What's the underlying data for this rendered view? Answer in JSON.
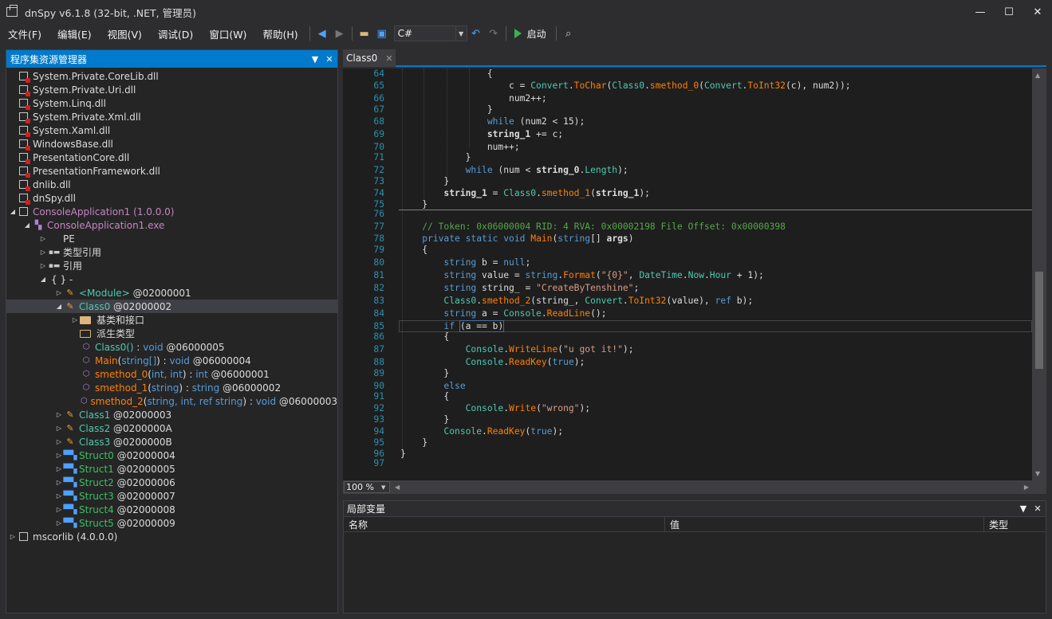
{
  "window": {
    "title": "dnSpy v6.1.8 (32-bit, .NET, 管理员)",
    "minimize": "—",
    "maximize": "☐",
    "close": "✕"
  },
  "menu": {
    "items": [
      "文件(F)",
      "编辑(E)",
      "视图(V)",
      "调试(D)",
      "窗口(W)",
      "帮助(H)"
    ]
  },
  "toolbar": {
    "language": "C#",
    "start_label": "启动"
  },
  "explorer": {
    "title": "程序集资源管理器",
    "dlls": [
      "System.Private.CoreLib.dll",
      "System.Private.Uri.dll",
      "System.Linq.dll",
      "System.Private.Xml.dll",
      "System.Xaml.dll",
      "WindowsBase.dll",
      "PresentationCore.dll",
      "PresentationFramework.dll",
      "dnlib.dll",
      "dnSpy.dll"
    ],
    "assembly": "ConsoleApplication1 (1.0.0.0)",
    "module": "ConsoleApplication1.exe",
    "pe": "PE",
    "typerefs": "类型引用",
    "refs": "引用",
    "ns": "{ } -",
    "module_type": {
      "name": "<Module>",
      "token": "@02000001"
    },
    "class0": {
      "name": "Class0",
      "token": "@02000002"
    },
    "base_types": "基类和接口",
    "derived_types": "派生类型",
    "members": [
      {
        "name": "Class0()",
        "sig": " : ",
        "ret": "void",
        "token": " @06000005"
      },
      {
        "name": "Main",
        "sig": "(",
        "params": "string[]",
        "close": ") : ",
        "ret": "void",
        "token": " @06000004"
      },
      {
        "name": "smethod_0",
        "sig": "(",
        "params": "int, int",
        "close": ") : ",
        "ret": "int",
        "token": " @06000001"
      },
      {
        "name": "smethod_1",
        "sig": "(",
        "params": "string",
        "close": ") : ",
        "ret": "string",
        "token": " @06000002"
      },
      {
        "name": "smethod_2",
        "sig": "(",
        "params": "string, int, ref string",
        "close": ") : ",
        "ret": "void",
        "token": " @06000003"
      }
    ],
    "classes": [
      {
        "name": "Class1",
        "token": "@02000003"
      },
      {
        "name": "Class2",
        "token": "@0200000A"
      },
      {
        "name": "Class3",
        "token": "@0200000B"
      }
    ],
    "structs": [
      {
        "name": "Struct0",
        "token": "@02000004"
      },
      {
        "name": "Struct1",
        "token": "@02000005"
      },
      {
        "name": "Struct2",
        "token": "@02000006"
      },
      {
        "name": "Struct3",
        "token": "@02000007"
      },
      {
        "name": "Struct4",
        "token": "@02000008"
      },
      {
        "name": "Struct5",
        "token": "@02000009"
      }
    ],
    "mscorlib": "mscorlib (4.0.0.0)"
  },
  "editor": {
    "tab": "Class0",
    "zoom": "100 %",
    "line_numbers": [
      "64",
      "65",
      "66",
      "67",
      "68",
      "69",
      "70",
      "71",
      "72",
      "73",
      "74",
      "75",
      "76",
      "77",
      "78",
      "79",
      "80",
      "81",
      "82",
      "83",
      "84",
      "85",
      "86",
      "87",
      "88",
      "89",
      "90",
      "91",
      "92",
      "93",
      "94",
      "95",
      "96",
      "97"
    ]
  },
  "locals": {
    "title": "局部变量",
    "columns": [
      "名称",
      "值",
      "类型"
    ]
  }
}
